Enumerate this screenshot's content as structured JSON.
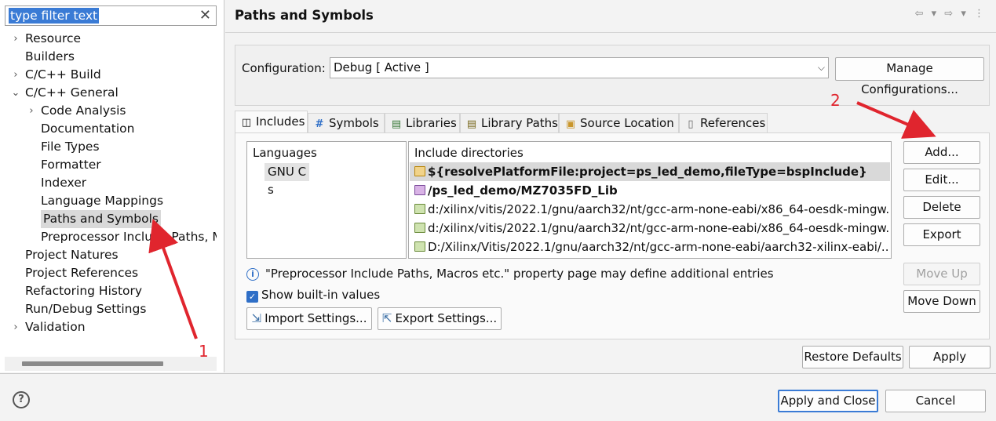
{
  "filter": {
    "value": "type filter text"
  },
  "tree": [
    {
      "label": "Resource",
      "twisty": "›"
    },
    {
      "label": "Builders",
      "twisty": ""
    },
    {
      "label": "C/C++ Build",
      "twisty": "›"
    },
    {
      "label": "C/C++ General",
      "twisty": "⌄"
    },
    {
      "label": "Code Analysis",
      "twisty": "›"
    },
    {
      "label": "Documentation",
      "twisty": ""
    },
    {
      "label": "File Types",
      "twisty": ""
    },
    {
      "label": "Formatter",
      "twisty": ""
    },
    {
      "label": "Indexer",
      "twisty": ""
    },
    {
      "label": "Language Mappings",
      "twisty": ""
    },
    {
      "label": "Paths and Symbols",
      "twisty": ""
    },
    {
      "label": "Preprocessor Include Paths, Ma",
      "twisty": ""
    },
    {
      "label": "Project Natures",
      "twisty": ""
    },
    {
      "label": "Project References",
      "twisty": ""
    },
    {
      "label": "Refactoring History",
      "twisty": ""
    },
    {
      "label": "Run/Debug Settings",
      "twisty": ""
    },
    {
      "label": "Validation",
      "twisty": "›"
    }
  ],
  "page": {
    "title": "Paths and Symbols",
    "nav": "⇦ ▾ ⇨ ▾ ⋮"
  },
  "config": {
    "label": "Configuration:",
    "value": "Debug  [ Active ]",
    "manage_button": "Manage Configurations..."
  },
  "tabs": [
    {
      "label": "Includes",
      "icon": "includes-icon",
      "glyph": "◫"
    },
    {
      "label": "Symbols",
      "icon": "hash-icon",
      "glyph": "#"
    },
    {
      "label": "Libraries",
      "icon": "libraries-icon",
      "glyph": "▤"
    },
    {
      "label": "Library Paths",
      "icon": "library-paths-icon",
      "glyph": "▤"
    },
    {
      "label": "Source Location",
      "icon": "source-location-icon",
      "glyph": "▣"
    },
    {
      "label": "References",
      "icon": "references-icon",
      "glyph": "▯"
    }
  ],
  "languages": {
    "header": "Languages",
    "items": [
      "GNU C",
      "s"
    ]
  },
  "includes": {
    "header": "Include directories",
    "items": [
      "${resolvePlatformFile:project=ps_led_demo,fileType=bspInclude}",
      "/ps_led_demo/MZ7035FD_Lib",
      "d:/xilinx/vitis/2022.1/gnu/aarch32/nt/gcc-arm-none-eabi/x86_64-oesdk-mingw...",
      "d:/xilinx/vitis/2022.1/gnu/aarch32/nt/gcc-arm-none-eabi/x86_64-oesdk-mingw...",
      "D:/Xilinx/Vitis/2022.1/gnu/aarch32/nt/gcc-arm-none-eabi/aarch32-xilinx-eabi/..."
    ]
  },
  "side_buttons": {
    "add": "Add...",
    "edit": "Edit...",
    "delete": "Delete",
    "export": "Export",
    "move_up": "Move Up",
    "move_down": "Move Down"
  },
  "info_text": "\"Preprocessor Include Paths, Macros etc.\" property page may define additional entries",
  "show_builtin": {
    "label": "Show built-in values",
    "checked": true
  },
  "import_button": "Import Settings...",
  "export_button": "Export Settings...",
  "restore_defaults": "Restore Defaults",
  "apply": "Apply",
  "apply_close": "Apply and Close",
  "cancel": "Cancel",
  "help_glyph": "?",
  "annotations": {
    "one": "1",
    "two": "2",
    "color": "#e0252e"
  }
}
